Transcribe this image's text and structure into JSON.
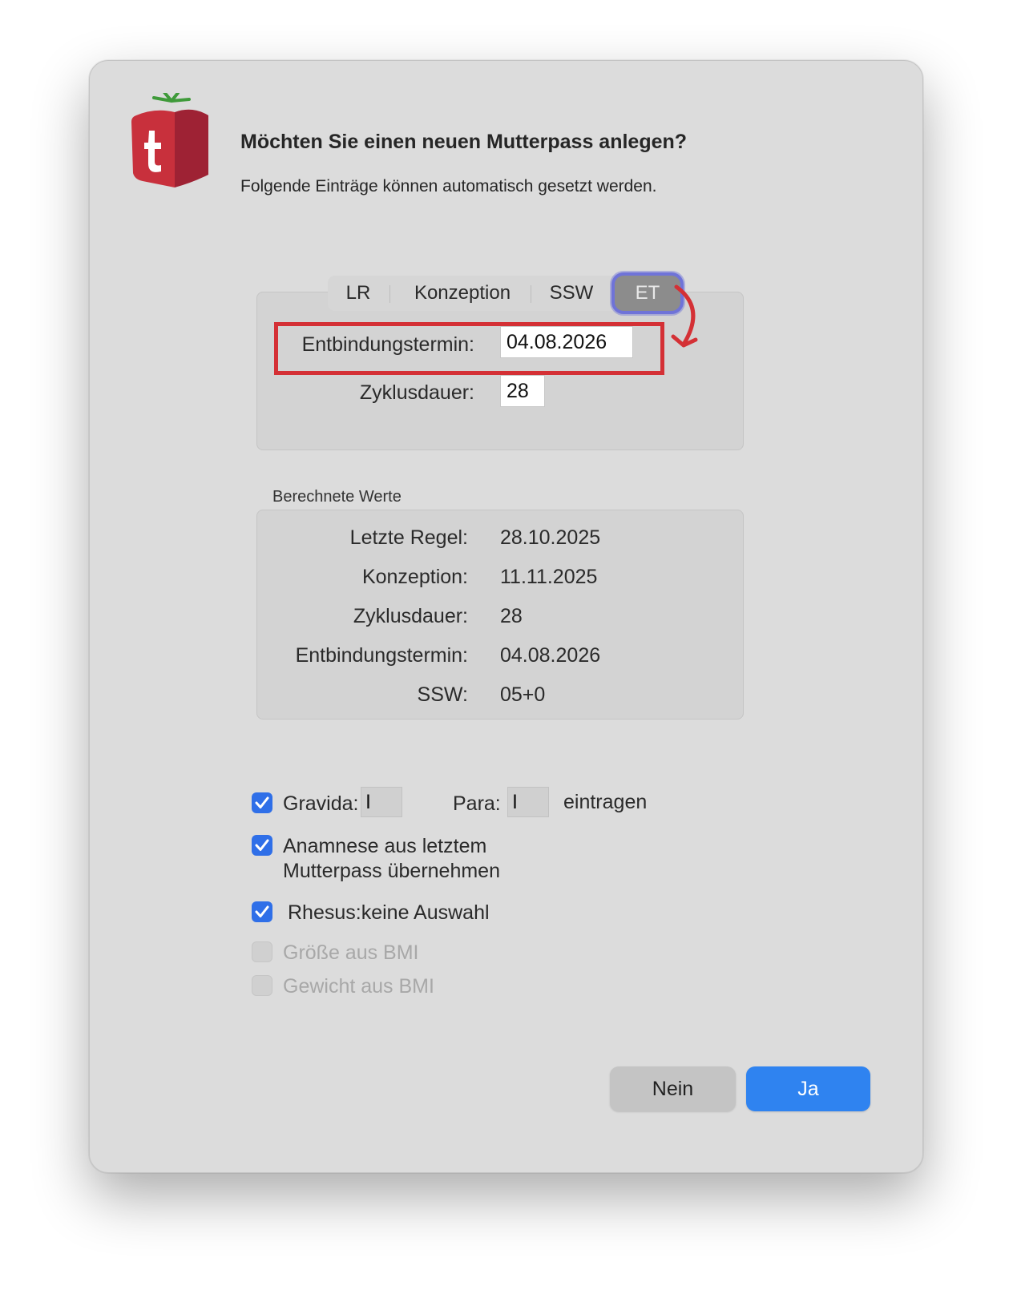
{
  "dialog": {
    "title": "Möchten Sie einen neuen Mutterpass anlegen?",
    "subtitle": "Folgende Einträge können automatisch gesetzt werden."
  },
  "segments": {
    "items": [
      "LR",
      "Konzeption",
      "SSW",
      "ET"
    ],
    "selected": "ET"
  },
  "input": {
    "due_date_label": "Entbindungstermin:",
    "due_date_value": "04.08.2026",
    "cycle_label": "Zyklusdauer:",
    "cycle_value": "28"
  },
  "calculated": {
    "caption": "Berechnete Werte",
    "rows": [
      {
        "label": "Letzte Regel:",
        "value": "28.10.2025"
      },
      {
        "label": "Konzeption:",
        "value": "11.11.2025"
      },
      {
        "label": "Zyklusdauer:",
        "value": "28"
      },
      {
        "label": "Entbindungstermin:",
        "value": "04.08.2026"
      },
      {
        "label": "SSW:",
        "value": "05+0"
      }
    ]
  },
  "options": {
    "gravida_label": "Gravida:",
    "gravida_value": "I",
    "para_label": "Para:",
    "para_value": "I",
    "eintragen_label": "eintragen",
    "anamnese_line1": "Anamnese aus letztem",
    "anamnese_line2": "Mutterpass übernehmen",
    "rhesus_label": "Rhesus:keine Auswahl",
    "groesse_label": "Größe aus BMI",
    "gewicht_label": "Gewicht aus BMI",
    "checked": {
      "gravida": true,
      "anamnese": true,
      "rhesus": true,
      "groesse": false,
      "gewicht": false
    }
  },
  "buttons": {
    "no": "Nein",
    "yes": "Ja"
  },
  "app_icon": {
    "letter": "t",
    "name": "app-logo-icon"
  },
  "colors": {
    "accent": "#2f83f0",
    "highlight_box": "#d43035",
    "logo_red": "#c8303c",
    "logo_leaf": "#3f9a3a",
    "selected_segment": "#8c8c8c",
    "focus_ring": "#6f73d8"
  }
}
